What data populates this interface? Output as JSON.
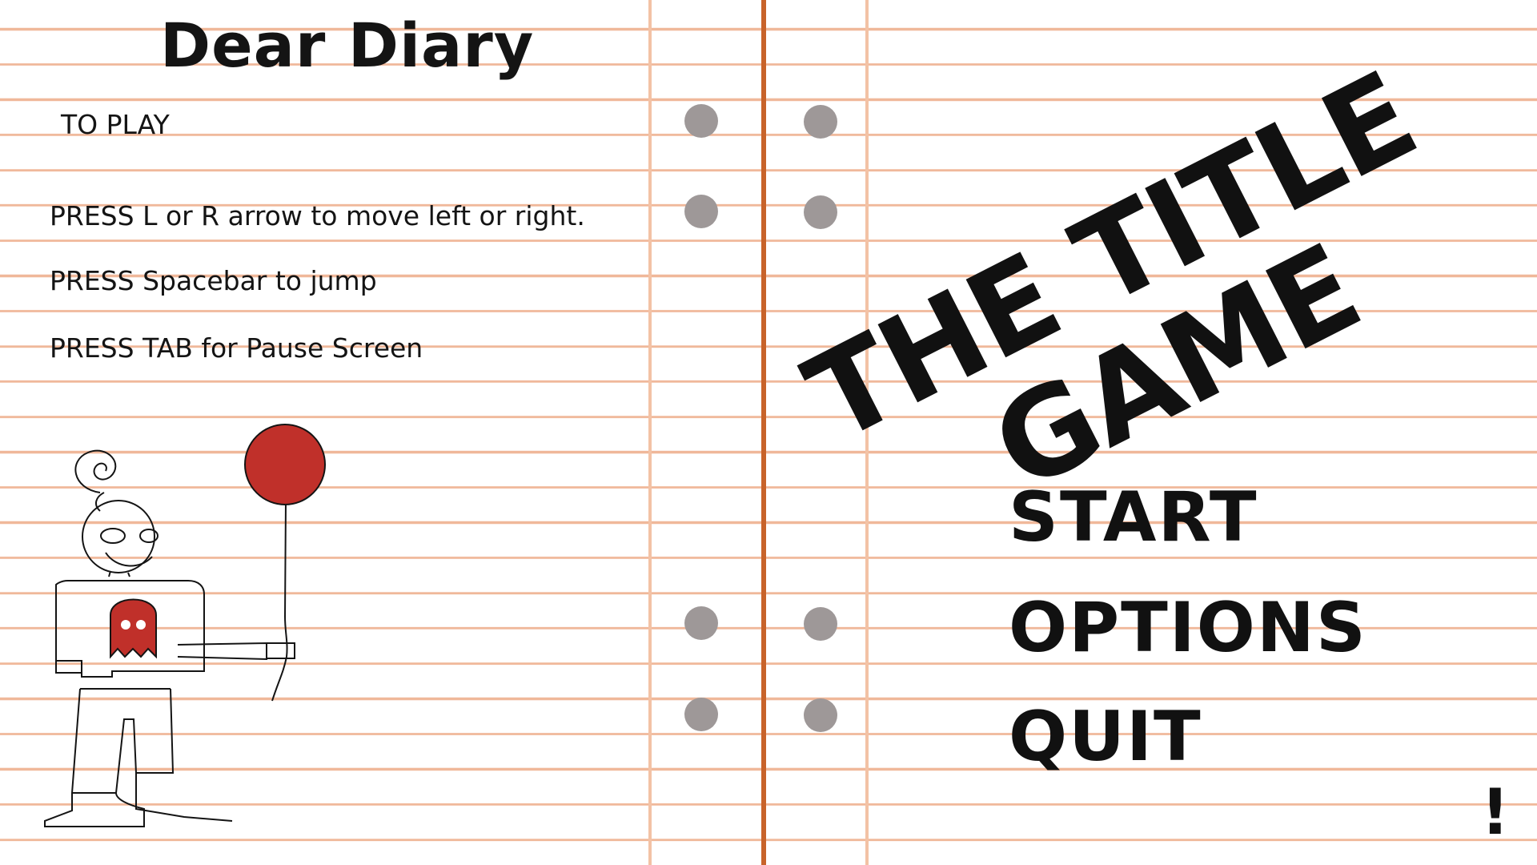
{
  "diary": {
    "title": "Dear Diary",
    "heading": "TO PLAY",
    "instructions": [
      "PRESS L or R arrow to move left or right.",
      "PRESS Spacebar to jump",
      "PRESS TAB for Pause Screen"
    ]
  },
  "game_title": {
    "line1": "THE TITLE",
    "line2": "GAME"
  },
  "menu": {
    "start": "START",
    "options": "OPTIONS",
    "quit": "QUIT"
  },
  "corner_mark": "!",
  "icons": {
    "holes": "binder-hole",
    "character": "stick-figure-with-balloon",
    "shirt_graphic": "ghost-icon"
  },
  "colors": {
    "paper_line": "#f0b89a",
    "margin_line": "#f3c2a5",
    "spine": "#c8632a",
    "hole": "#9e9898",
    "balloon": "#c0302a",
    "ink": "#141414"
  }
}
